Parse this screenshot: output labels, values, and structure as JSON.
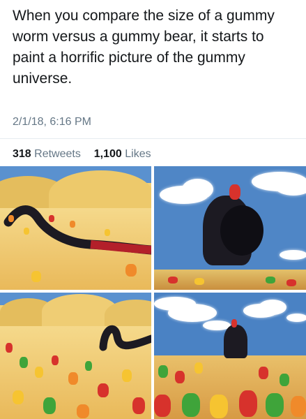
{
  "tweet": {
    "text": "When you compare the size of a gummy worm versus a gummy bear, it starts to paint a horrific picture of the gummy universe.",
    "timestamp": "2/1/18, 6:16 PM",
    "retweets_count": "318",
    "retweets_label": "Retweets",
    "likes_count": "1,100",
    "likes_label": "Likes"
  },
  "images": {
    "colors": {
      "sky": "#4f86c6",
      "sand": "#f1cf76",
      "worm": "#1c1a22",
      "worm_tail": "#b3202a",
      "gummy_red": "#d7322c",
      "gummy_orange": "#f08a2a",
      "gummy_yellow": "#f6c431",
      "gummy_green": "#3fa43a",
      "cloud": "#ffffff"
    }
  }
}
